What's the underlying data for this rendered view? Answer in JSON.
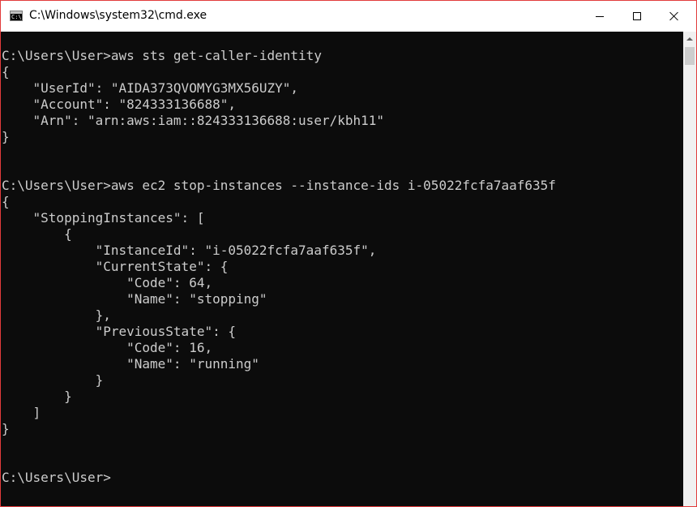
{
  "window": {
    "title": "C:\\Windows\\system32\\cmd.exe",
    "icon_label": "C:\\."
  },
  "console": {
    "lines": [
      "C:\\Users\\User>aws sts get-caller-identity",
      "{",
      "    \"UserId\": \"AIDA373QVOMYG3MX56UZY\",",
      "    \"Account\": \"824333136688\",",
      "    \"Arn\": \"arn:aws:iam::824333136688:user/kbh11\"",
      "}",
      "",
      "",
      "C:\\Users\\User>aws ec2 stop-instances --instance-ids i-05022fcfa7aaf635f",
      "{",
      "    \"StoppingInstances\": [",
      "        {",
      "            \"InstanceId\": \"i-05022fcfa7aaf635f\",",
      "            \"CurrentState\": {",
      "                \"Code\": 64,",
      "                \"Name\": \"stopping\"",
      "            },",
      "            \"PreviousState\": {",
      "                \"Code\": 16,",
      "                \"Name\": \"running\"",
      "            }",
      "        }",
      "    ]",
      "}",
      "",
      "",
      "C:\\Users\\User>"
    ]
  },
  "icons": {
    "minimize": "minimize-icon",
    "maximize": "maximize-icon",
    "close": "close-icon"
  }
}
